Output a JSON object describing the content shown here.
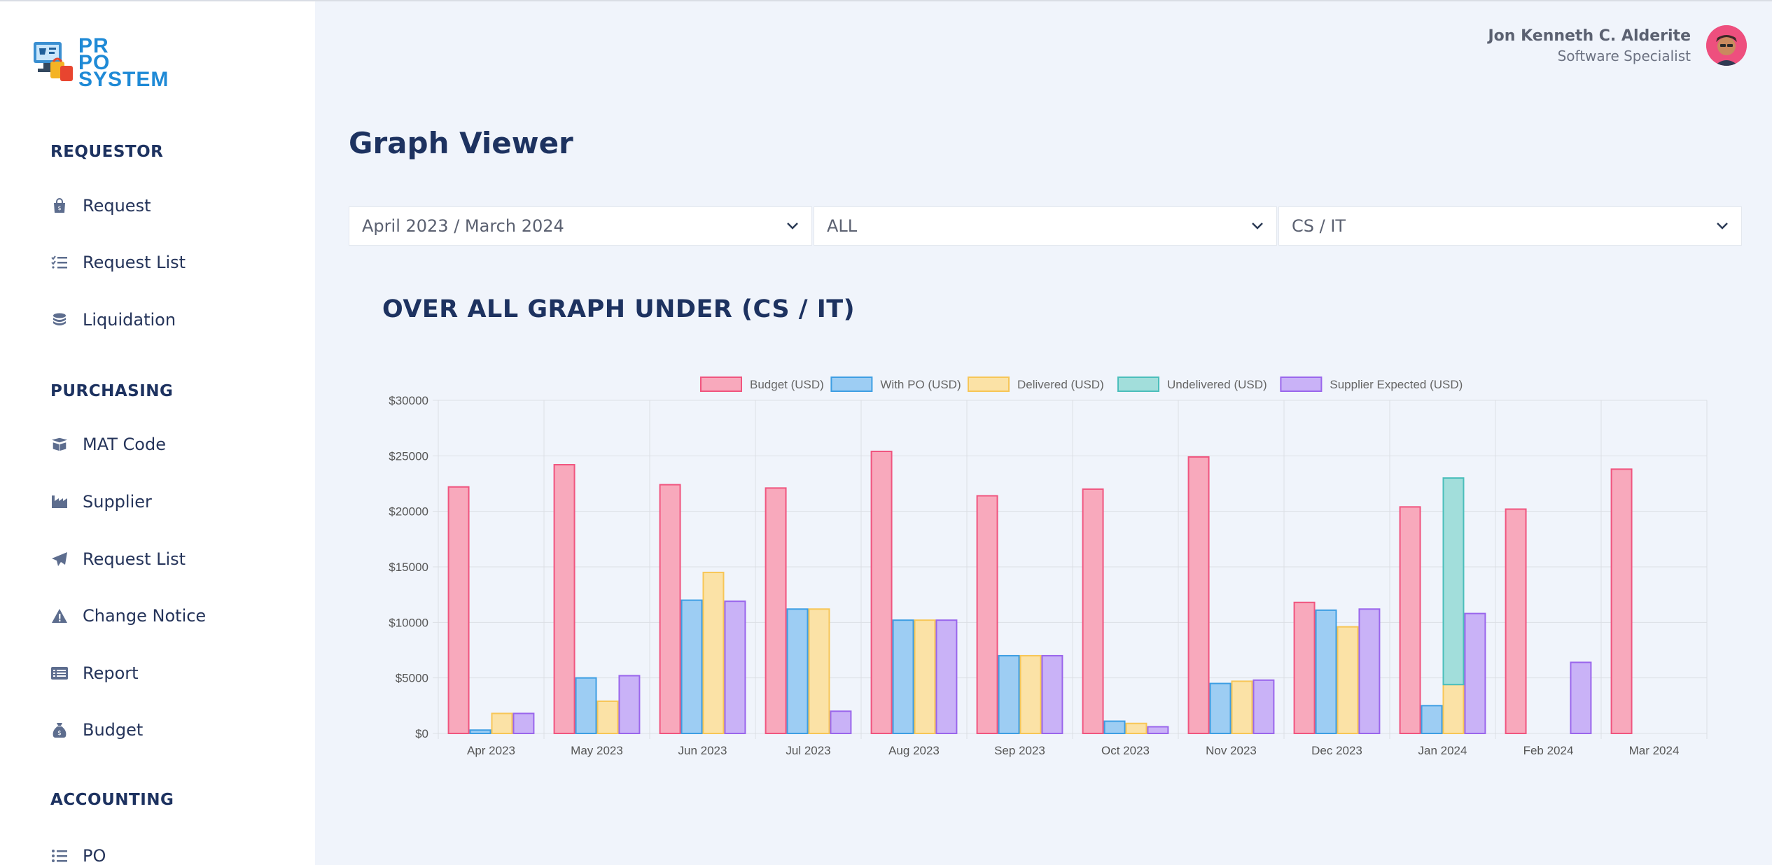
{
  "app": {
    "logo_text": [
      "PR",
      "PO",
      "SYSTEM"
    ]
  },
  "user": {
    "name": "Jon Kenneth C. Alderite",
    "role": "Software Specialist"
  },
  "sidebar": {
    "sections": [
      {
        "title": "REQUESTOR",
        "items": [
          {
            "label": "Request",
            "icon": "shopping-bag-icon"
          },
          {
            "label": "Request List",
            "icon": "checklist-icon"
          },
          {
            "label": "Liquidation",
            "icon": "coins-icon"
          }
        ]
      },
      {
        "title": "PURCHASING",
        "items": [
          {
            "label": "MAT Code",
            "icon": "box-open-icon"
          },
          {
            "label": "Supplier",
            "icon": "factory-icon"
          },
          {
            "label": "Request List",
            "icon": "paper-plane-icon"
          },
          {
            "label": "Change Notice",
            "icon": "warning-icon"
          },
          {
            "label": "Report",
            "icon": "list-alt-icon"
          },
          {
            "label": "Budget",
            "icon": "money-bag-icon"
          }
        ]
      },
      {
        "title": "ACCOUNTING",
        "items": [
          {
            "label": "PO",
            "icon": "list-icon"
          }
        ]
      }
    ]
  },
  "page": {
    "title": "Graph Viewer",
    "filters": [
      {
        "value": "April 2023 / March 2024"
      },
      {
        "value": "ALL"
      },
      {
        "value": "CS / IT"
      }
    ],
    "chart_title": "OVER ALL GRAPH UNDER (CS / IT)"
  },
  "chart_data": {
    "type": "bar",
    "categories": [
      "Apr 2023",
      "May 2023",
      "Jun 2023",
      "Jul 2023",
      "Aug 2023",
      "Sep 2023",
      "Oct 2023",
      "Nov 2023",
      "Dec 2023",
      "Jan 2024",
      "Feb 2024",
      "Mar 2024"
    ],
    "series": [
      {
        "name": "Budget (USD)",
        "fill": "#f8a9bc",
        "stroke": "#f0557f",
        "values": [
          22200,
          24200,
          22400,
          22100,
          25400,
          21400,
          22000,
          24900,
          11800,
          20400,
          20200,
          23800
        ]
      },
      {
        "name": "With PO (USD)",
        "fill": "#9dcdf3",
        "stroke": "#3e9ee3",
        "values": [
          300,
          5000,
          12000,
          11200,
          10200,
          7000,
          1100,
          4500,
          11100,
          2500,
          0,
          0
        ]
      },
      {
        "name": "Delivered (USD)",
        "fill": "#fbe2a6",
        "stroke": "#f7c657",
        "values": [
          1800,
          2900,
          14500,
          11200,
          10200,
          7000,
          900,
          4700,
          9600,
          4400,
          0,
          0
        ]
      },
      {
        "name": "Undelivered (USD)",
        "fill": "#a2dedb",
        "stroke": "#4bbebb",
        "values": [
          0,
          0,
          0,
          0,
          0,
          0,
          0,
          0,
          0,
          18600,
          0,
          0
        ],
        "stacked_on": "Delivered (USD)"
      },
      {
        "name": "Supplier Expected (USD)",
        "fill": "#c9b2f7",
        "stroke": "#9a66ec",
        "values": [
          1800,
          5200,
          11900,
          2000,
          10200,
          7000,
          600,
          4800,
          11200,
          10800,
          6400,
          0
        ]
      }
    ],
    "ylim": [
      0,
      30000
    ],
    "yticks": [
      0,
      5000,
      10000,
      15000,
      20000,
      25000,
      30000
    ],
    "ytick_labels": [
      "$0",
      "$5000",
      "$10000",
      "$15000",
      "$20000",
      "$25000",
      "$30000"
    ],
    "legend_position": "top-center",
    "grid": true
  }
}
